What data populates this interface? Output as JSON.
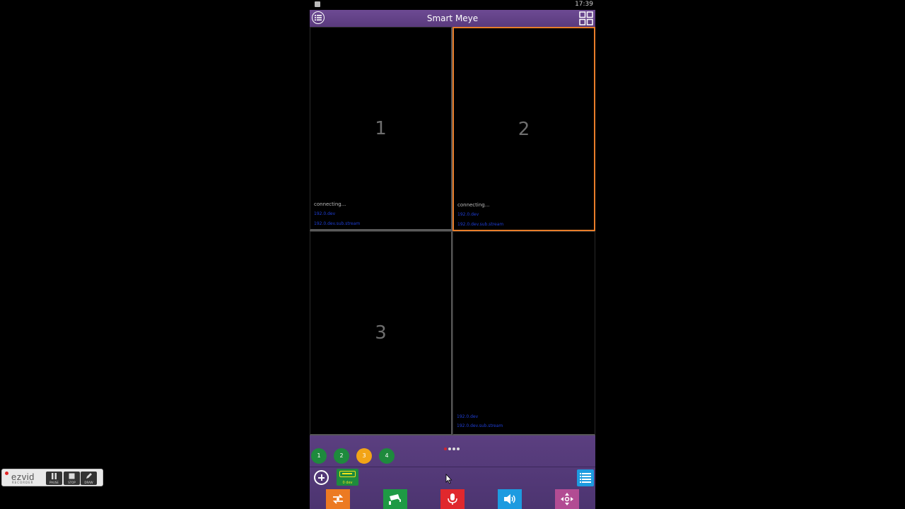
{
  "statusbar": {
    "time": "17:39"
  },
  "app": {
    "title": "Smart Meye"
  },
  "cells": [
    {
      "number": "1",
      "status": "connecting...",
      "info1": "192.0.dev",
      "info2": "192.0.dev.sub.stream"
    },
    {
      "number": "2",
      "status": "connecting...",
      "info1": "192.0.dev",
      "info2": "192.0.dev.sub.stream"
    },
    {
      "number": "3",
      "status": "",
      "info1": "",
      "info2": ""
    },
    {
      "number": "",
      "status": "",
      "info1": "192.0.dev",
      "info2": "192.0.dev.sub.stream"
    }
  ],
  "channels": [
    "1",
    "2",
    "3",
    "4"
  ],
  "selected_channel": "3",
  "device_button": {
    "label": "0 dev"
  },
  "recorder": {
    "brand": "ezvid",
    "brand_sub": "RECORDER",
    "pause": "PAUSE",
    "stop": "STOP",
    "draw": "DRAW"
  },
  "colors": {
    "appbar": "#5f4185",
    "selected_cell_border": "#e87d2a",
    "channel_green": "#1e8a3d",
    "channel_selected": "#f2a417",
    "action_orange": "#ec7a22",
    "action_green": "#1e9a44",
    "action_red": "#e0282d",
    "action_blue": "#1d9be0",
    "action_pink": "#b24c93"
  },
  "icons": {
    "menu": "menu-circle-icon",
    "grid": "grid-layout-icon",
    "add": "add-circle-icon",
    "device": "dvr-device-icon",
    "list": "list-icon",
    "switch": "switch-stream-icon",
    "camera": "cctv-camera-icon",
    "mic": "microphone-icon",
    "speaker": "speaker-icon",
    "ptz": "ptz-arrows-icon"
  }
}
